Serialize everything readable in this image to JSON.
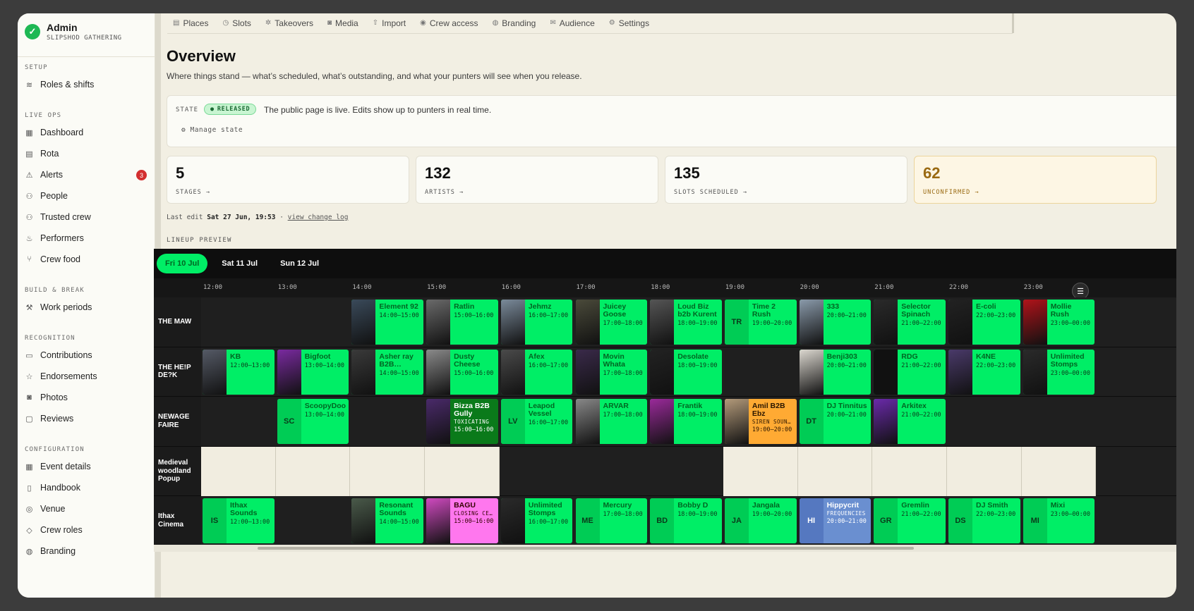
{
  "brand": {
    "title": "Admin",
    "subtitle": "SLIPSHOD GATHERING"
  },
  "sidebar": {
    "sections": [
      {
        "heading": "SETUP",
        "items": [
          {
            "label": "Roles & shifts",
            "icon": "layers-icon"
          }
        ]
      },
      {
        "heading": "LIVE OPS",
        "items": [
          {
            "label": "Dashboard",
            "icon": "dashboard-icon"
          },
          {
            "label": "Rota",
            "icon": "clipboard-icon"
          },
          {
            "label": "Alerts",
            "icon": "warning-icon",
            "badge": "3"
          },
          {
            "label": "People",
            "icon": "users-icon"
          },
          {
            "label": "Trusted crew",
            "icon": "user-check-icon"
          },
          {
            "label": "Performers",
            "icon": "flame-icon"
          },
          {
            "label": "Crew food",
            "icon": "utensils-icon"
          }
        ]
      },
      {
        "heading": "BUILD & BREAK",
        "items": [
          {
            "label": "Work periods",
            "icon": "hammer-icon"
          }
        ]
      },
      {
        "heading": "RECOGNITION",
        "items": [
          {
            "label": "Contributions",
            "icon": "file-icon"
          },
          {
            "label": "Endorsements",
            "icon": "star-icon"
          },
          {
            "label": "Photos",
            "icon": "camera-icon"
          },
          {
            "label": "Reviews",
            "icon": "message-icon"
          }
        ]
      },
      {
        "heading": "CONFIGURATION",
        "items": [
          {
            "label": "Event details",
            "icon": "calendar-icon"
          },
          {
            "label": "Handbook",
            "icon": "book-icon"
          },
          {
            "label": "Venue",
            "icon": "map-pin-icon"
          },
          {
            "label": "Crew roles",
            "icon": "tag-icon"
          },
          {
            "label": "Branding",
            "icon": "palette-icon"
          }
        ]
      }
    ]
  },
  "tabs": [
    {
      "label": "Places",
      "icon": "places-icon"
    },
    {
      "label": "Slots",
      "icon": "clock-icon"
    },
    {
      "label": "Takeovers",
      "icon": "takeover-icon"
    },
    {
      "label": "Media",
      "icon": "camera-icon"
    },
    {
      "label": "Import",
      "icon": "upload-icon"
    },
    {
      "label": "Crew access",
      "icon": "eye-icon"
    },
    {
      "label": "Branding",
      "icon": "palette-icon"
    },
    {
      "label": "Audience",
      "icon": "mail-icon"
    },
    {
      "label": "Settings",
      "icon": "gear-icon"
    }
  ],
  "page": {
    "title": "Overview",
    "lead": "Where things stand — what’s scheduled, what’s outstanding, and what your punters will see when you release."
  },
  "state": {
    "label": "STATE",
    "badge": "RELEASED",
    "text": "The public page is live. Edits show up to punters in real time.",
    "manage": "Manage state"
  },
  "stats": [
    {
      "value": "5",
      "label": "STAGES →"
    },
    {
      "value": "132",
      "label": "ARTISTS →"
    },
    {
      "value": "135",
      "label": "SLOTS SCHEDULED →"
    },
    {
      "value": "62",
      "label": "UNCONFIRMED →",
      "warn": true
    }
  ],
  "last_edit": {
    "prefix": "Last edit",
    "when": "Sat 27 Jun, 19:53",
    "sep": "·",
    "link": "view change log"
  },
  "lineup": {
    "heading": "LINEUP PREVIEW",
    "days": [
      "Fri 10 Jul",
      "Sat 11 Jul",
      "Sun 12 Jul"
    ],
    "active_day": 0,
    "hours": [
      "12:00",
      "13:00",
      "14:00",
      "15:00",
      "16:00",
      "17:00",
      "18:00",
      "19:00",
      "20:00",
      "21:00",
      "22:00",
      "23:00"
    ],
    "stages": [
      {
        "name": "THE MAW",
        "slots": [
          {
            "name": "Element 92",
            "time": "14:00–15:00",
            "start": 14,
            "thumb": "#3a4a5a"
          },
          {
            "name": "Ratlin",
            "time": "15:00–16:00",
            "start": 15,
            "thumb": "#6a6a6a"
          },
          {
            "name": "Jehmz",
            "time": "16:00–17:00",
            "start": 16,
            "thumb": "#7a8a9a"
          },
          {
            "name": "Juicey Goose",
            "time": "17:00–18:00",
            "start": 17,
            "thumb": "#4a4a3a"
          },
          {
            "name": "Loud Biz b2b Kurent",
            "time": "18:00–19:00",
            "start": 18,
            "thumb": "#555"
          },
          {
            "name": "Time 2 Rush",
            "time": "19:00–20:00",
            "start": 19,
            "init": "TR"
          },
          {
            "name": "333",
            "time": "20:00–21:00",
            "start": 20,
            "thumb": "#8a9aaa"
          },
          {
            "name": "Selector Spinach",
            "time": "21:00–22:00",
            "start": 21,
            "thumb": "#2a2a2a"
          },
          {
            "name": "E-coli",
            "time": "22:00–23:00",
            "start": 22,
            "thumb": "#222"
          },
          {
            "name": "Mollie Rush",
            "time": "23:00–00:00",
            "start": 23,
            "thumb": "#b0131a"
          }
        ]
      },
      {
        "name": "THE HE!P DE?K",
        "slots": [
          {
            "name": "KB",
            "time": "12:00–13:00",
            "start": 12,
            "thumb": "#555a66"
          },
          {
            "name": "Bigfoot",
            "time": "13:00–14:00",
            "start": 13,
            "thumb": "#7a2aa0"
          },
          {
            "name": "Asher ray B2B…",
            "time": "14:00–15:00",
            "start": 14,
            "thumb": "#3a3a3a"
          },
          {
            "name": "Dusty Cheese",
            "time": "15:00–16:00",
            "start": 15,
            "thumb": "#8a8a8a"
          },
          {
            "name": "Afex",
            "time": "16:00–17:00",
            "start": 16,
            "thumb": "#4a4a4a"
          },
          {
            "name": "Movin Whata",
            "time": "17:00–18:00",
            "start": 17,
            "thumb": "#3a2a4a"
          },
          {
            "name": "Desolate",
            "time": "18:00–19:00",
            "start": 18,
            "thumb": "#222"
          },
          {
            "name": "Benji303",
            "time": "20:00–21:00",
            "start": 20,
            "thumb": "#dcd8d0"
          },
          {
            "name": "RDG",
            "time": "21:00–22:00",
            "start": 21,
            "thumb": "#111"
          },
          {
            "name": "K4NE",
            "time": "22:00–23:00",
            "start": 22,
            "thumb": "#4a3a6a"
          },
          {
            "name": "Unlimited Stomps",
            "time": "23:00–00:00",
            "start": 23,
            "thumb": "#2a2a2a"
          }
        ]
      },
      {
        "name": "NEWAGE FAIRE",
        "slots": [
          {
            "name": "ScoopyDoo",
            "time": "13:00–14:00",
            "start": 13,
            "init": "SC"
          },
          {
            "name": "Bizza B2B Gully",
            "time": "15:00–16:00",
            "start": 15,
            "thumb": "#4a2a6a",
            "sub": "TOXICATING",
            "style": "dkgreen"
          },
          {
            "name": "Leapod Vessel",
            "time": "16:00–17:00",
            "start": 16,
            "init": "LV"
          },
          {
            "name": "ARVAR",
            "time": "17:00–18:00",
            "start": 17,
            "thumb": "#888"
          },
          {
            "name": "Frantik",
            "time": "18:00–19:00",
            "start": 18,
            "thumb": "#9a2a9a"
          },
          {
            "name": "Amil B2B Ebz",
            "time": "19:00–20:00",
            "start": 19,
            "thumb": "#b39a7a",
            "sub": "SIREN SOUN…",
            "style": "orange"
          },
          {
            "name": "DJ Tinnitus",
            "time": "20:00–21:00",
            "start": 20,
            "init": "DT"
          },
          {
            "name": "Arkitex",
            "time": "21:00–22:00",
            "start": 21,
            "thumb": "#6a2aaa"
          }
        ]
      },
      {
        "name": "Medieval woodland Popup",
        "beige": true,
        "slots": []
      },
      {
        "name": "Ithax Cinema",
        "slots": [
          {
            "name": "Ithax Sounds",
            "time": "12:00–13:00",
            "start": 12,
            "init": "IS"
          },
          {
            "name": "Resonant Sounds",
            "time": "14:00–15:00",
            "start": 14,
            "thumb": "#4a5a4a"
          },
          {
            "name": "BAGU",
            "time": "15:00–16:00",
            "start": 15,
            "thumb": "#d04ac0",
            "sub": "CLOSING CE…",
            "style": "pink"
          },
          {
            "name": "Unlimited Stomps",
            "time": "16:00–17:00",
            "start": 16,
            "thumb": "#2a2a2a"
          },
          {
            "name": "Mercury",
            "time": "17:00–18:00",
            "start": 17,
            "init": "ME"
          },
          {
            "name": "Bobby D",
            "time": "18:00–19:00",
            "start": 18,
            "init": "BD"
          },
          {
            "name": "Jangala",
            "time": "19:00–20:00",
            "start": 19,
            "init": "JA"
          },
          {
            "name": "Hippycrit",
            "time": "20:00–21:00",
            "start": 20,
            "init": "HI",
            "sub": "FREQUENCIES",
            "style": "blue"
          },
          {
            "name": "Gremlin",
            "time": "21:00–22:00",
            "start": 21,
            "init": "GR"
          },
          {
            "name": "DJ Smith",
            "time": "22:00–23:00",
            "start": 22,
            "init": "DS"
          },
          {
            "name": "Mixi",
            "time": "23:00–00:00",
            "start": 23,
            "init": "MI"
          }
        ]
      }
    ]
  }
}
